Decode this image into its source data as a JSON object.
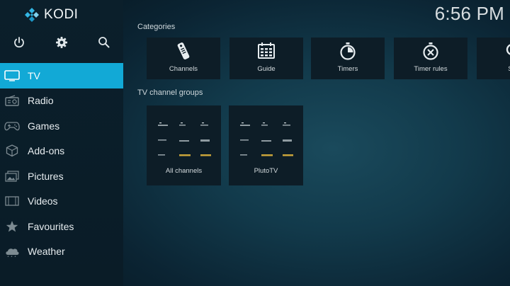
{
  "app": {
    "name": "KODI"
  },
  "clock": "6:56 PM",
  "top_buttons": [
    "power-icon",
    "gear-icon",
    "search-icon"
  ],
  "menu": [
    {
      "label": "TV",
      "icon": "tv-icon",
      "active": true
    },
    {
      "label": "Radio",
      "icon": "radio-icon"
    },
    {
      "label": "Games",
      "icon": "gamepad-icon"
    },
    {
      "label": "Add-ons",
      "icon": "addons-box-icon"
    },
    {
      "label": "Pictures",
      "icon": "pictures-icon"
    },
    {
      "label": "Videos",
      "icon": "film-icon"
    },
    {
      "label": "Favourites",
      "icon": "star-icon"
    },
    {
      "label": "Weather",
      "icon": "weather-cloud-icon"
    }
  ],
  "categories": {
    "title": "Categories",
    "items": [
      {
        "label": "Channels",
        "icon": "remote-control-icon"
      },
      {
        "label": "Guide",
        "icon": "guide-grid-icon"
      },
      {
        "label": "Timers",
        "icon": "stopwatch-icon"
      },
      {
        "label": "Timer rules",
        "icon": "timer-rules-icon"
      },
      {
        "label": "Se",
        "icon": "search-icon"
      }
    ]
  },
  "channel_groups": {
    "title": "TV channel groups",
    "items": [
      {
        "label": "All channels"
      },
      {
        "label": "PlutoTV"
      }
    ]
  },
  "colors": {
    "accent": "#12a9d6",
    "sidebar": "#0b1f2b",
    "tile": "#0d1d27"
  }
}
